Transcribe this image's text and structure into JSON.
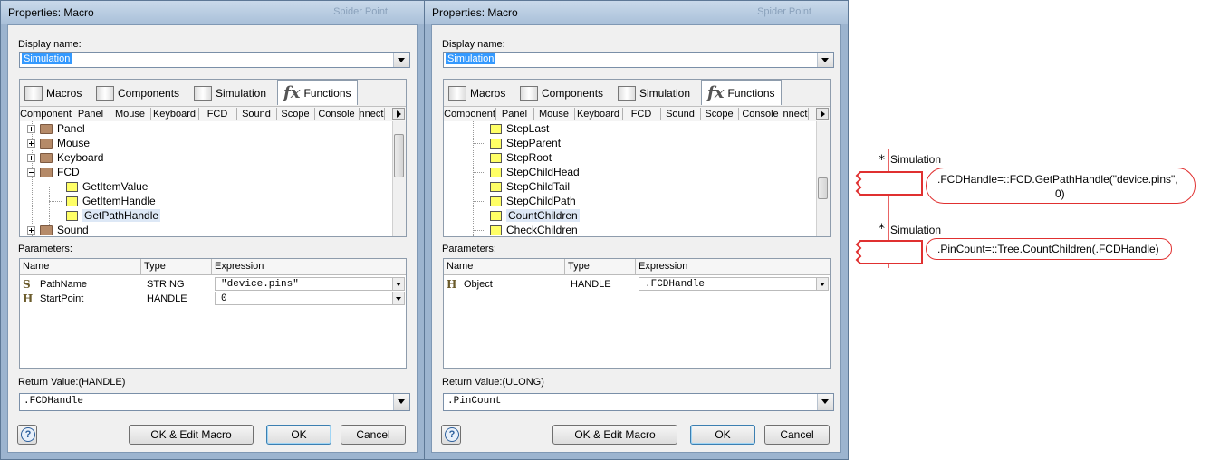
{
  "left": {
    "title": "Properties: Macro",
    "ghost": "Spider Point",
    "display_name_label": "Display name:",
    "display_name_value": "Simulation",
    "tabs": [
      "Macros",
      "Components",
      "Simulation",
      "Functions"
    ],
    "subtabs": [
      "Component",
      "Panel",
      "Mouse",
      "Keyboard",
      "FCD",
      "Sound",
      "Scope",
      "Console",
      "nnect"
    ],
    "tree": {
      "items": [
        "Panel",
        "Mouse",
        "Keyboard",
        "FCD",
        "GetItemValue",
        "GetItemHandle",
        "GetPathHandle",
        "Sound"
      ]
    },
    "parameters_label": "Parameters:",
    "columns": [
      "Name",
      "Type",
      "Expression"
    ],
    "rows": [
      {
        "icon": "S",
        "name": "PathName",
        "type": "STRING",
        "expr": "\"device.pins\""
      },
      {
        "icon": "H",
        "name": "StartPoint",
        "type": "HANDLE",
        "expr": "0"
      }
    ],
    "return_label": "Return Value:(HANDLE)",
    "return_value": ".FCDHandle",
    "buttons": {
      "ok_edit": "OK & Edit Macro",
      "ok": "OK",
      "cancel": "Cancel",
      "help": "?"
    }
  },
  "right": {
    "title": "Properties: Macro",
    "ghost": "Spider Point",
    "display_name_label": "Display name:",
    "display_name_value": "Simulation",
    "tabs": [
      "Macros",
      "Components",
      "Simulation",
      "Functions"
    ],
    "subtabs": [
      "Component",
      "Panel",
      "Mouse",
      "Keyboard",
      "FCD",
      "Sound",
      "Scope",
      "Console",
      "nnect"
    ],
    "tree": {
      "items": [
        "StepLast",
        "StepParent",
        "StepRoot",
        "StepChildHead",
        "StepChildTail",
        "StepChildPath",
        "CountChildren",
        "CheckChildren"
      ]
    },
    "parameters_label": "Parameters:",
    "columns": [
      "Name",
      "Type",
      "Expression"
    ],
    "rows": [
      {
        "icon": "H",
        "name": "Object",
        "type": "HANDLE",
        "expr": ".FCDHandle"
      }
    ],
    "return_label": "Return Value:(ULONG)",
    "return_value": ".PinCount",
    "buttons": {
      "ok_edit": "OK & Edit Macro",
      "ok": "OK",
      "cancel": "Cancel",
      "help": "?"
    }
  },
  "flowchart": {
    "block1": {
      "label": "Simulation",
      "text_line1": ".FCDHandle=::FCD.GetPathHandle(\"device.pins\",",
      "text_line2": "0)"
    },
    "block2": {
      "label": "Simulation",
      "text": ".PinCount=::Tree.CountChildren(.FCDHandle)"
    }
  }
}
